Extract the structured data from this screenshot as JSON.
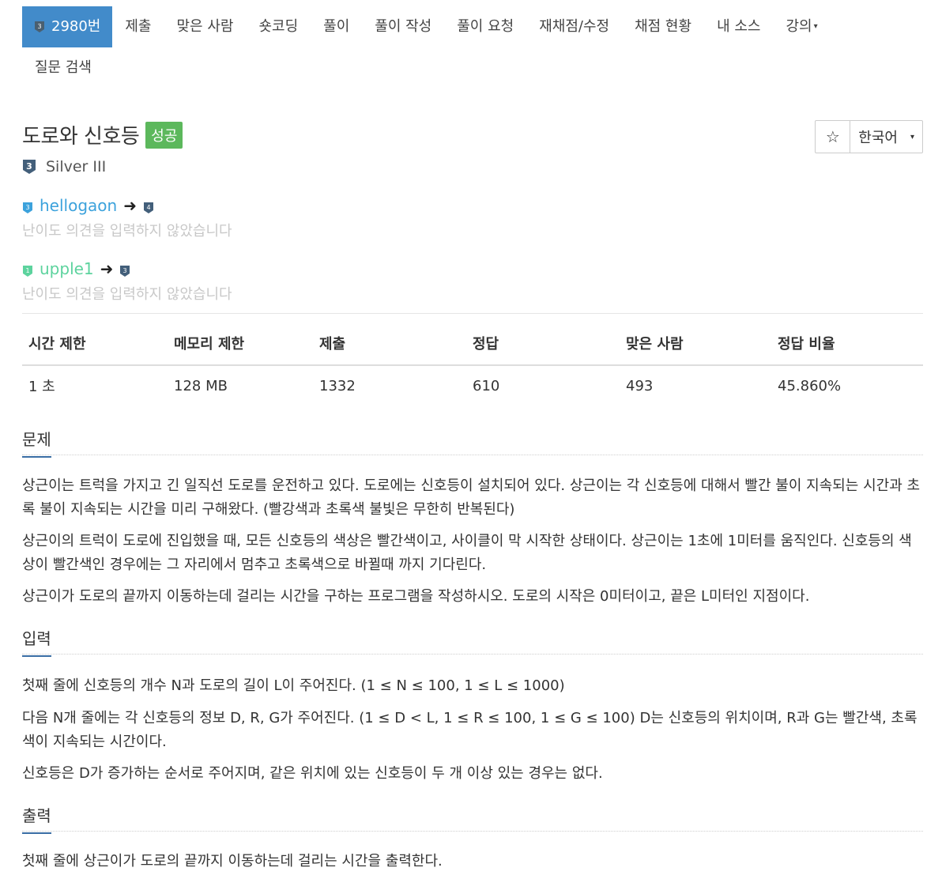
{
  "nav": {
    "problem_number": "2980번",
    "items": [
      "제출",
      "맞은 사람",
      "숏코딩",
      "풀이",
      "풀이 작성",
      "풀이 요청",
      "재채점/수정",
      "채점 현황",
      "내 소스",
      "강의"
    ],
    "row2": [
      "질문 검색"
    ]
  },
  "title": {
    "text": "도로와 신호등",
    "badge": "성공"
  },
  "actions": {
    "star": "☆",
    "language": "한국어"
  },
  "tier": {
    "label": "Silver III",
    "icon_number": "3"
  },
  "opinions": [
    {
      "user": "hellogaon",
      "from_tier": "3",
      "to_tier": "4",
      "text": "난이도 의견을 입력하지 않았습니다"
    },
    {
      "user": "upple1",
      "from_tier": "1",
      "to_tier": "3",
      "text": "난이도 의견을 입력하지 않았습니다"
    }
  ],
  "stats": {
    "headers": [
      "시간 제한",
      "메모리 제한",
      "제출",
      "정답",
      "맞은 사람",
      "정답 비율"
    ],
    "values": [
      "1 초",
      "128 MB",
      "1332",
      "610",
      "493",
      "45.860%"
    ]
  },
  "sections": {
    "problem": {
      "title": "문제",
      "paragraphs": [
        "상근이는 트럭을 가지고 긴 일직선 도로를 운전하고 있다. 도로에는 신호등이 설치되어 있다. 상근이는 각 신호등에 대해서 빨간 불이 지속되는 시간과 초록 불이 지속되는 시간을 미리 구해왔다. (빨강색과 초록색 불빛은 무한히 반복된다)",
        "상근이의 트럭이 도로에 진입했을 때, 모든 신호등의 색상은 빨간색이고, 사이클이 막 시작한 상태이다. 상근이는 1초에 1미터를 움직인다. 신호등의 색상이 빨간색인 경우에는 그 자리에서 멈추고 초록색으로 바뀔때 까지 기다린다.",
        "상근이가 도로의 끝까지 이동하는데 걸리는 시간을 구하는 프로그램을 작성하시오. 도로의 시작은 0미터이고, 끝은 L미터인 지점이다."
      ]
    },
    "input": {
      "title": "입력",
      "paragraphs": [
        "첫째 줄에 신호등의 개수 N과 도로의 길이 L이 주어진다. (1 ≤ N ≤ 100, 1 ≤ L ≤ 1000)",
        "다음 N개 줄에는 각 신호등의 정보 D, R, G가 주어진다. (1 ≤ D < L, 1 ≤ R ≤ 100, 1 ≤ G ≤ 100) D는 신호등의 위치이며, R과 G는 빨간색, 초록색이 지속되는 시간이다.",
        "신호등은 D가 증가하는 순서로 주어지며, 같은 위치에 있는 신호등이 두 개 이상 있는 경우는 없다."
      ]
    },
    "output": {
      "title": "출력",
      "paragraphs": [
        "첫째 줄에 상근이가 도로의 끝까지 이동하는데 걸리는 시간을 출력한다."
      ]
    }
  },
  "colors": {
    "nav_active": "#428bca",
    "success": "#5cb85c",
    "user_blue": "#3ca2dc",
    "user_green": "#5dd39e",
    "muted": "#c8c8c8"
  }
}
